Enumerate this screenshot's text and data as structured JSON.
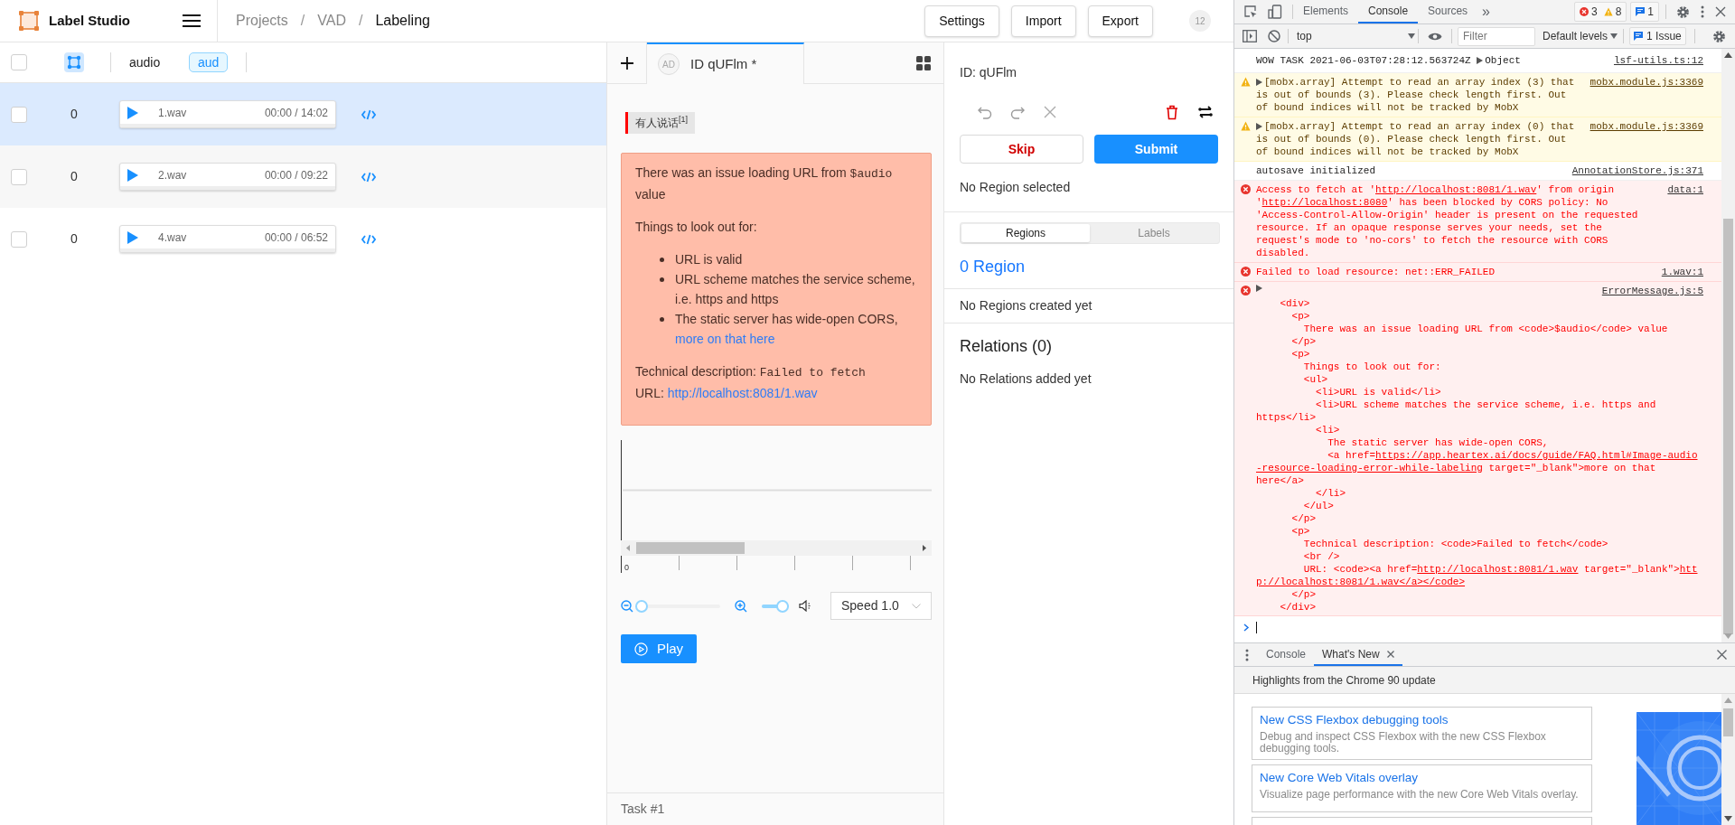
{
  "app": {
    "brand": "Label Studio",
    "breadcrumbs": [
      {
        "label": "Projects",
        "current": false,
        "separator": "/"
      },
      {
        "label": "VAD",
        "current": false,
        "separator": "/"
      },
      {
        "label": "Labeling",
        "current": true
      }
    ],
    "actions": [
      "Settings",
      "Import",
      "Export"
    ],
    "user_badge": "12"
  },
  "tasks_table": {
    "header": {
      "checked": false,
      "column": "audio",
      "tag": "aud"
    },
    "rows": [
      {
        "checked": false,
        "selected": true,
        "annotations": "0",
        "file": "1.wav",
        "time": "00:00 / 14:02"
      },
      {
        "checked": false,
        "selected": false,
        "annotations": "0",
        "file": "2.wav",
        "time": "00:00 / 09:22"
      },
      {
        "checked": false,
        "selected": false,
        "annotations": "0",
        "file": "4.wav",
        "time": "00:00 / 06:52"
      }
    ]
  },
  "labeling": {
    "tabs": [
      {
        "avatar": "AD",
        "label": "ID qUFlm *",
        "selected": true
      }
    ],
    "labels": [
      {
        "text": "有人说话$^{[1]}$"
      }
    ],
    "error": {
      "intro": [
        {
          "text": "There was an issue loading URL from "
        },
        {
          "text": "$audio",
          "code": true
        },
        {
          "text": " value"
        }
      ],
      "list_title": "Things to look out for:",
      "items": [
        [
          {
            "text": "URL is valid"
          }
        ],
        [
          {
            "text": "URL scheme matches the service scheme, i.e. https and https"
          }
        ],
        [
          {
            "text": "The static server has wide-open CORS, "
          },
          {
            "text": "more on that here",
            "link": true
          }
        ]
      ],
      "details": [
        {
          "text": "Technical description: "
        },
        {
          "text": "Failed to fetch",
          "code": true
        }
      ],
      "url": [
        {
          "text": "URL: "
        },
        {
          "text": "http://localhost:8081/1.wav",
          "link": true
        }
      ]
    },
    "timeline": {
      "tick_label": "0"
    },
    "zoom": {
      "level": 0
    },
    "volume": {
      "level": 1
    },
    "speed": "Speed 1.0",
    "play": "Play",
    "footer": "Task #1"
  },
  "annotation_panel": {
    "id": "ID: qUFlm",
    "skip": "Skip",
    "submit": "Submit",
    "selection": "No Region selected",
    "tabs": [
      {
        "label": "Regions",
        "selected": true
      },
      {
        "label": "Labels",
        "selected": false
      }
    ],
    "region_count": "0 Region",
    "regions_empty": "No Regions created yet",
    "relations_title": "Relations (0)",
    "relations_empty": "No Relations added yet"
  },
  "devtools": {
    "tabs": [
      {
        "label": "Elements",
        "selected": false
      },
      {
        "label": "Console",
        "selected": true
      },
      {
        "label": "Sources",
        "selected": false
      }
    ],
    "more": "»",
    "errors": "3",
    "warnings": "8",
    "messages": "1",
    "context": "top",
    "filter_placeholder": "Filter",
    "levels": "Default levels",
    "issues": "1 Issue",
    "console": [
      {
        "kind": "log",
        "parts": [
          {
            "text": "WOW TASK 2021-06-03T07:28:12.563724Z "
          },
          {
            "text": "Object",
            "toggle": true
          }
        ],
        "source": "lsf-utils.ts:12"
      },
      {
        "kind": "warning",
        "toggle": true,
        "parts": [
          {
            "text": "[mobx.array] Attempt to read an array index (3) that is out of bounds (3). Please check length first. Out of bound indices will not be tracked by MobX"
          }
        ],
        "source": "mobx.module.js:3369"
      },
      {
        "kind": "warning",
        "toggle": true,
        "parts": [
          {
            "text": "[mobx.array] Attempt to read an array index (0) that is out of bounds (0). Please check length first. Out of bound indices will not be tracked by MobX"
          }
        ],
        "source": "mobx.module.js:3369"
      },
      {
        "kind": "log",
        "parts": [
          {
            "text": "autosave initialized"
          }
        ],
        "source": "AnnotationStore.js:371"
      },
      {
        "kind": "error",
        "parts": [
          {
            "text": "Access to fetch at '"
          },
          {
            "text": "http://localhost:8081/1.wav",
            "underline": true
          },
          {
            "text": "' from origin '"
          },
          {
            "text": "http://localhost:8080",
            "underline": true
          },
          {
            "text": "' has been blocked by CORS policy: No 'Access-Control-Allow-Origin' header is present on the requested resource. If an opaque response serves your needs, set the request's mode to 'no-cors' to fetch the resource with CORS disabled."
          }
        ],
        "source": "data:1"
      },
      {
        "kind": "error",
        "parts": [
          {
            "text": "Failed to load resource: net::ERR_FAILED"
          }
        ],
        "source": "1.wav:1"
      },
      {
        "kind": "error",
        "toggle": true,
        "source": "ErrorMessage.js:5",
        "lines": [
          [
            {
              "text": "    <div>"
            }
          ],
          [
            {
              "text": "      <p>"
            }
          ],
          [
            {
              "text": "        There was an issue loading URL from <code>$audio</code> value"
            }
          ],
          [
            {
              "text": "      </p>"
            }
          ],
          [
            {
              "text": "      <p>"
            }
          ],
          [
            {
              "text": "        Things to look out for:"
            }
          ],
          [
            {
              "text": "        <ul>"
            }
          ],
          [
            {
              "text": "          <li>URL is valid</li>"
            }
          ],
          [
            {
              "text": "          <li>URL scheme matches the service scheme, i.e. https and"
            }
          ],
          [
            {
              "text": "https</li>"
            }
          ],
          [
            {
              "text": "          <li>"
            }
          ],
          [
            {
              "text": "            The static server has wide-open CORS,"
            }
          ],
          [
            {
              "text": "            <a href="
            },
            {
              "text": "https://app.heartex.ai/docs/guide/FAQ.html#Image-audio",
              "underline": true
            }
          ],
          [
            {
              "text": "-resource-loading-error-while-labeling",
              "underline": true
            },
            {
              "text": " target=\"_blank\">more on that"
            }
          ],
          [
            {
              "text": "here</a>"
            }
          ],
          [
            {
              "text": "          </li>"
            }
          ],
          [
            {
              "text": "        </ul>"
            }
          ],
          [
            {
              "text": "      </p>"
            }
          ],
          [
            {
              "text": "      <p>"
            }
          ],
          [
            {
              "text": "        Technical description: <code>Failed to fetch</code>"
            }
          ],
          [
            {
              "text": "        <br />"
            }
          ],
          [
            {
              "text": "        URL: <code><a href="
            },
            {
              "text": "http://localhost:8081/1.wav",
              "underline": true
            },
            {
              "text": " target=\"_blank\">"
            },
            {
              "text": "htt",
              "underline": true
            }
          ],
          [
            {
              "text": "p://localhost:8081/1.wav</a></code>",
              "underline": true
            }
          ],
          [
            {
              "text": "      </p>"
            }
          ],
          [
            {
              "text": "    </div>"
            }
          ]
        ]
      }
    ],
    "drawer": {
      "tabs": [
        {
          "label": "Console",
          "selected": false,
          "closable": false
        },
        {
          "label": "What's New",
          "selected": true,
          "closable": true
        }
      ],
      "heading": "Highlights from the Chrome 90 update",
      "cards": [
        {
          "title": "New CSS Flexbox debugging tools",
          "text": "Debug and inspect CSS Flexbox with the new CSS Flexbox debugging tools."
        },
        {
          "title": "New Core Web Vitals overlay",
          "text": "Visualize page performance with the new Core Web Vitals overlay."
        }
      ]
    }
  }
}
